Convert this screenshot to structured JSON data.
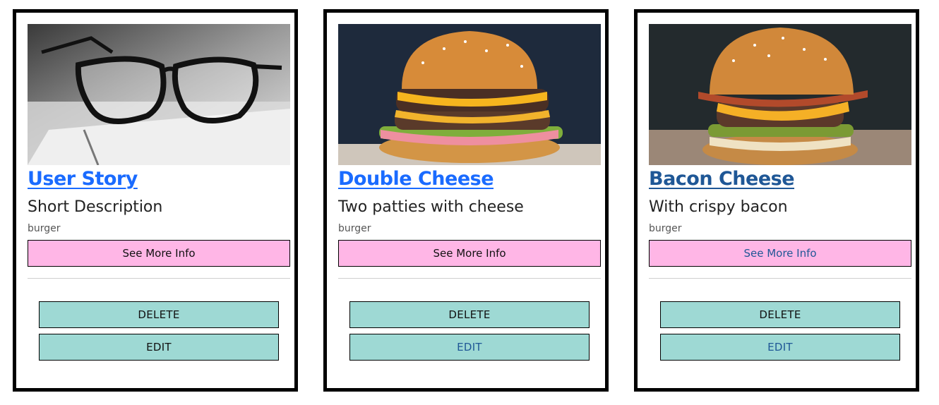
{
  "cards": [
    {
      "title": "User Story",
      "description": "Short Description",
      "category": "burger",
      "image": "glasses-photo",
      "more_info_label": "See More Info",
      "delete_label": "DELETE",
      "edit_label": "EDIT"
    },
    {
      "title": "Double Cheese",
      "description": "Two patties with cheese",
      "category": "burger",
      "image": "double-cheeseburger-photo",
      "more_info_label": "See More Info",
      "delete_label": "DELETE",
      "edit_label": "EDIT"
    },
    {
      "title": "Bacon Cheese",
      "description": "With crispy bacon",
      "category": "burger",
      "image": "bacon-cheeseburger-photo",
      "more_info_label": "See More Info",
      "delete_label": "DELETE",
      "edit_label": "EDIT"
    }
  ],
  "colors": {
    "link": "#1a6bff",
    "visited_link": "#1f5796",
    "info_button": "#ffb6e6",
    "action_button": "#9ed9d4",
    "card_border": "#000000"
  }
}
